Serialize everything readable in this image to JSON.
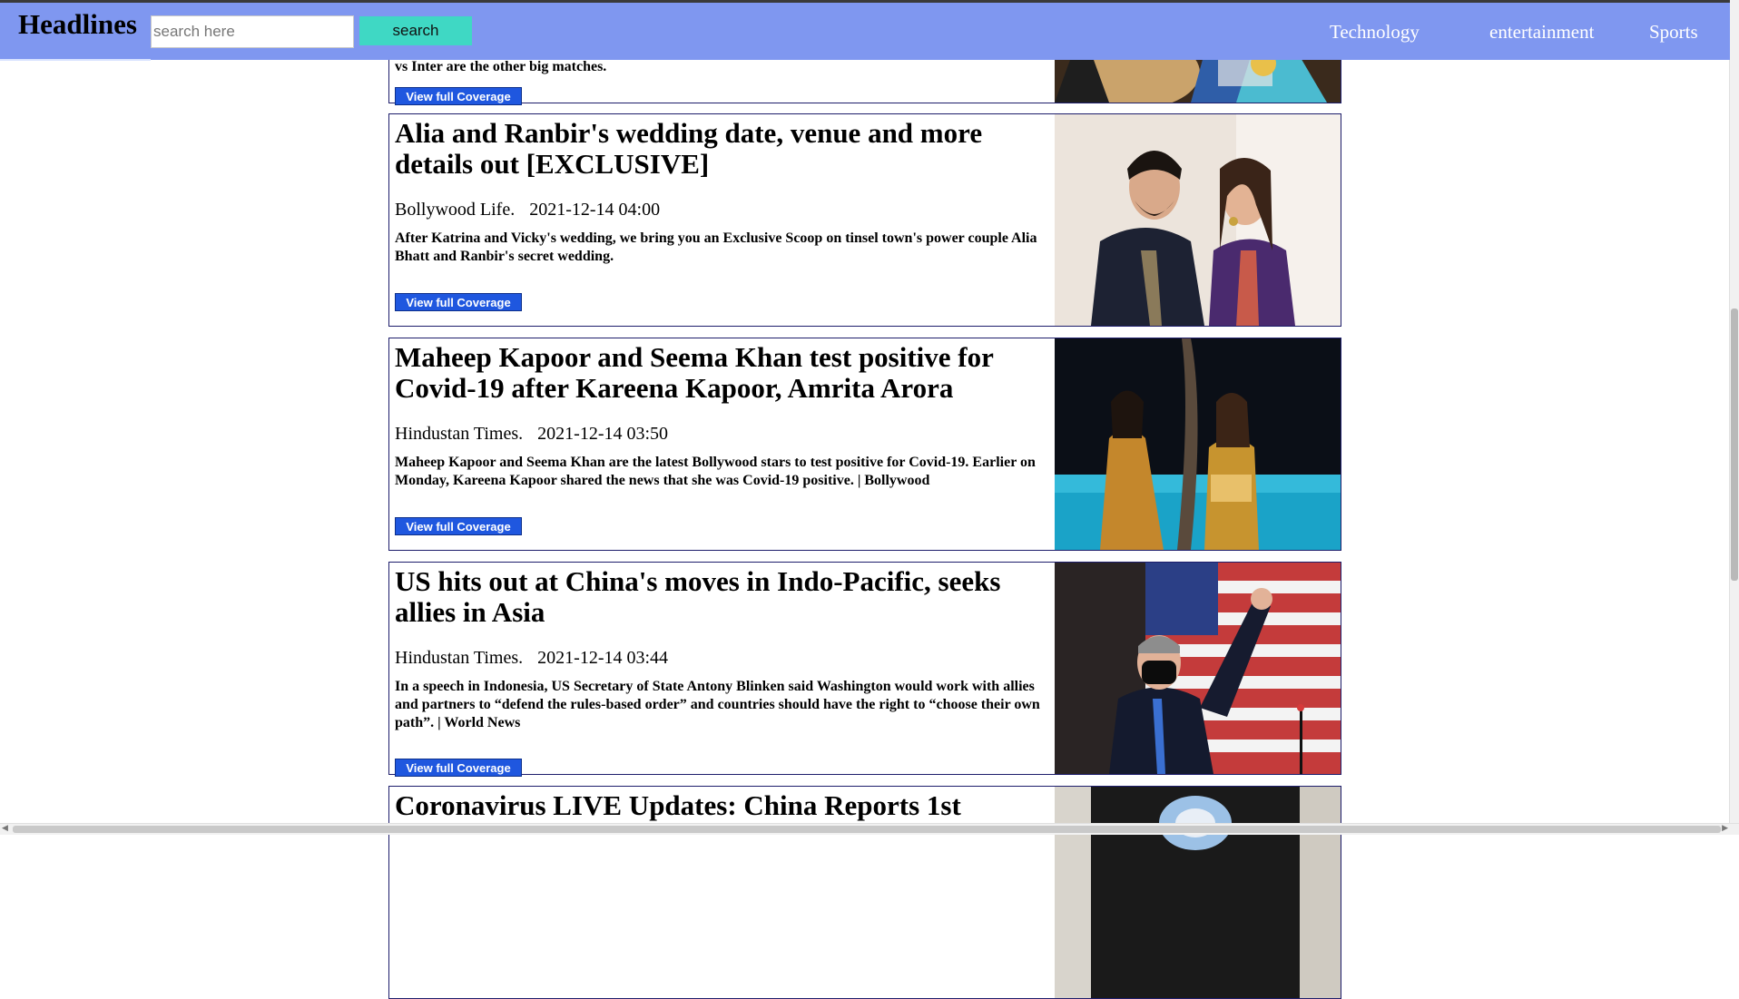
{
  "header": {
    "brand": "Headlines",
    "search_placeholder": "search here",
    "search_button": "search",
    "nav": [
      "Technology",
      "entertainment",
      "Sports"
    ]
  },
  "articles": [
    {
      "title": "",
      "source": "",
      "date": "",
      "description": "vs Inter are the other big matches.",
      "button": "View full Coverage",
      "image_icon": "article-photo"
    },
    {
      "title": "Alia and Ranbir's wedding date, venue and more details out [EXCLUSIVE]",
      "source": "Bollywood Life.",
      "date": "2021-12-14 04:00",
      "description": "After Katrina and Vicky's wedding, we bring you an Exclusive Scoop on tinsel town's power couple Alia Bhatt and Ranbir's secret wedding.",
      "button": "View full Coverage",
      "image_icon": "couple-photo"
    },
    {
      "title": "Maheep Kapoor and Seema Khan test positive for Covid-19 after Kareena Kapoor, Amrita Arora",
      "source": "Hindustan Times.",
      "date": "2021-12-14 03:50",
      "description": "Maheep Kapoor and Seema Khan are the latest Bollywood stars to test positive for Covid-19. Earlier on Monday, Kareena Kapoor shared the news that she was Covid-19 positive.  | Bollywood",
      "button": "View full Coverage",
      "image_icon": "poolside-photo"
    },
    {
      "title": "US hits out at China's moves in Indo-Pacific, seeks allies in Asia",
      "source": "Hindustan Times.",
      "date": "2021-12-14 03:44",
      "description": "In a speech in Indonesia, US Secretary of State Antony Blinken said Washington would work with allies and partners to “defend the rules-based order” and countries should have the right to “choose their own path”. | World News",
      "button": "View full Coverage",
      "image_icon": "speaker-flag-photo"
    },
    {
      "title": "Coronavirus LIVE Updates: China Reports 1st",
      "source": "",
      "date": "",
      "description": "",
      "button": "",
      "image_icon": "hazmat-photo"
    }
  ]
}
